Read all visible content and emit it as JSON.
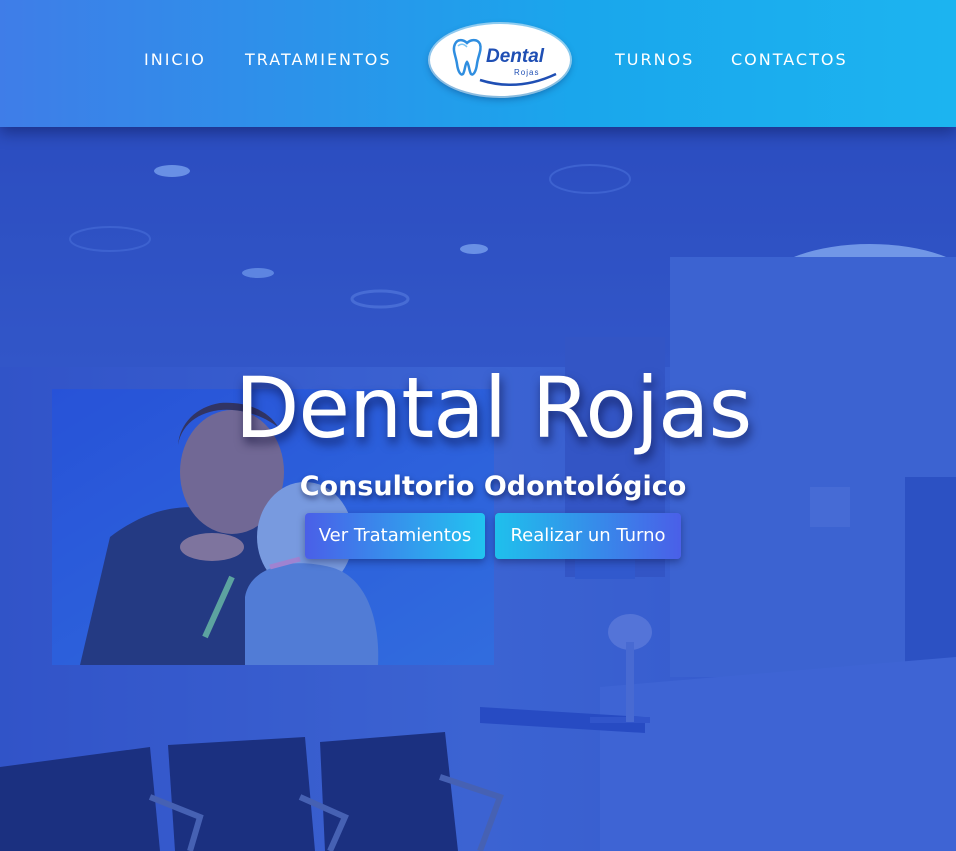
{
  "nav": {
    "left": [
      "INICIO",
      "TRATAMIENTOS"
    ],
    "right": [
      "TURNOS",
      "CONTACTOS"
    ],
    "logo": {
      "main": "Dental",
      "sub": "Rojas"
    }
  },
  "hero": {
    "title": "Dental Rojas",
    "subtitle": "Consultorio Odontológico",
    "buttons": [
      "Ver Tratamientos",
      "Realizar un Turno"
    ]
  },
  "colors": {
    "nav_start": "#3f7de8",
    "nav_end": "#1cb4f0",
    "overlay": "#2246c8",
    "logo_text": "#1f4fb4"
  }
}
